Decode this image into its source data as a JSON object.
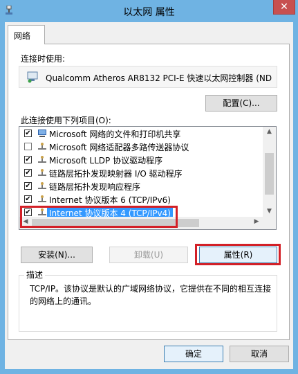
{
  "window": {
    "title": "以太网 属性",
    "close_glyph": "✕"
  },
  "tabs": [
    {
      "label": "网络"
    }
  ],
  "connect_using": {
    "label": "连接时使用:",
    "adapter": "Qualcomm Atheros AR8132 PCI-E 快速以太网控制器 (ND",
    "configure_button": "配置(C)..."
  },
  "items_section": {
    "label": "此连接使用下列项目(O):",
    "items": [
      {
        "label": "Microsoft 网络的文件和打印机共享",
        "checked": true,
        "icon": "network-share-icon"
      },
      {
        "label": "Microsoft 网络适配器多路传送器协议",
        "checked": false,
        "icon": "protocol-icon"
      },
      {
        "label": "Microsoft LLDP 协议驱动程序",
        "checked": true,
        "icon": "protocol-icon"
      },
      {
        "label": "链路层拓扑发现映射器 I/O 驱动程序",
        "checked": true,
        "icon": "protocol-icon"
      },
      {
        "label": "链路层拓扑发现响应程序",
        "checked": true,
        "icon": "protocol-icon"
      },
      {
        "label": "Internet 协议版本 6 (TCP/IPv6)",
        "checked": true,
        "icon": "protocol-icon"
      },
      {
        "label": "Internet 协议版本 4 (TCP/IPv4)",
        "checked": true,
        "icon": "protocol-icon",
        "selected": true
      }
    ]
  },
  "buttons": {
    "install": "安装(N)...",
    "uninstall": "卸载(U)",
    "properties": "属性(R)",
    "ok": "确定",
    "cancel": "取消"
  },
  "description": {
    "title": "描述",
    "text": "TCP/IP。该协议是默认的广域网络协议，它提供在不同的相互连接的网络上的通讯。"
  },
  "colors": {
    "highlight": "#d32027",
    "selection": "#3399ff",
    "titlebar": "#6fb3e3",
    "close": "#c75050"
  }
}
